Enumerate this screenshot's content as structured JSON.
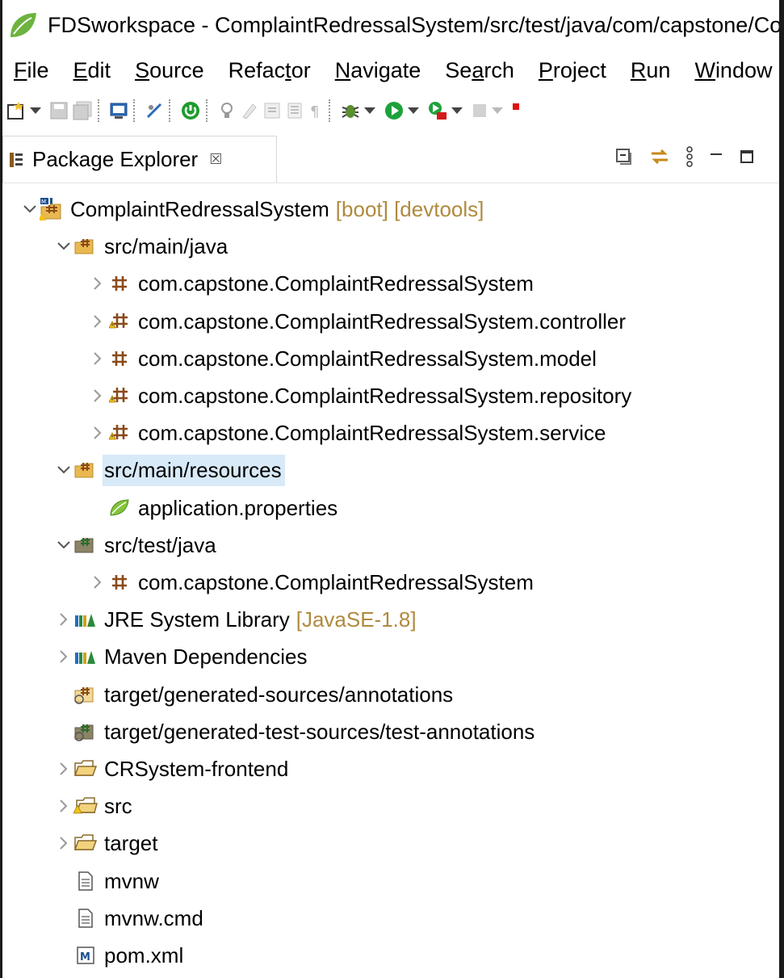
{
  "window": {
    "title": "FDSworkspace - ComplaintRedressalSystem/src/test/java/com/capstone/ComplaintRedressalSystem - Eclipse IDE"
  },
  "menu": [
    {
      "label": "File",
      "u": "F",
      "rest": "ile"
    },
    {
      "label": "Edit",
      "u": "E",
      "rest": "dit"
    },
    {
      "label": "Source",
      "u": "S",
      "rest": "ource"
    },
    {
      "label": "Refactor",
      "pre": "Refac",
      "u": "t",
      "rest": "or"
    },
    {
      "label": "Navigate",
      "u": "N",
      "rest": "avigate"
    },
    {
      "label": "Search",
      "pre": "Se",
      "u": "a",
      "rest": "rch"
    },
    {
      "label": "Project",
      "u": "P",
      "rest": "roject"
    },
    {
      "label": "Run",
      "u": "R",
      "rest": "un"
    },
    {
      "label": "Window",
      "u": "W",
      "rest": "indow"
    }
  ],
  "view": {
    "tab_label": "Package Explorer",
    "close_glyph": "☒"
  },
  "tree": [
    {
      "label": "ComplaintRedressalSystem",
      "decor": "[boot] [devtools]",
      "icon": "project-icon",
      "level": 0,
      "expanded": true
    },
    {
      "label": "src/main/java",
      "icon": "source-folder-icon",
      "level": 1,
      "expanded": true
    },
    {
      "label": "com.capstone.ComplaintRedressalSystem",
      "icon": "package-icon",
      "level": 2,
      "expanded": false
    },
    {
      "label": "com.capstone.ComplaintRedressalSystem.controller",
      "icon": "package-warning-icon",
      "level": 2,
      "expanded": false
    },
    {
      "label": "com.capstone.ComplaintRedressalSystem.model",
      "icon": "package-icon",
      "level": 2,
      "expanded": false
    },
    {
      "label": "com.capstone.ComplaintRedressalSystem.repository",
      "icon": "package-warning-icon",
      "level": 2,
      "expanded": false
    },
    {
      "label": "com.capstone.ComplaintRedressalSystem.service",
      "icon": "package-warning-icon",
      "level": 2,
      "expanded": false
    },
    {
      "label": "src/main/resources",
      "icon": "source-folder-icon",
      "level": 1,
      "expanded": true,
      "selected": true
    },
    {
      "label": "application.properties",
      "icon": "spring-leaf-icon",
      "level": 2
    },
    {
      "label": "src/test/java",
      "icon": "test-source-folder-icon",
      "level": 1,
      "expanded": true
    },
    {
      "label": "com.capstone.ComplaintRedressalSystem",
      "icon": "package-icon",
      "level": 2,
      "expanded": false
    },
    {
      "label": "JRE System Library",
      "decor": "[JavaSE-1.8]",
      "icon": "library-icon",
      "level": 1,
      "expanded": false
    },
    {
      "label": "Maven Dependencies",
      "icon": "library-icon",
      "level": 1,
      "expanded": false
    },
    {
      "label": "target/generated-sources/annotations",
      "icon": "gen-source-folder-icon",
      "level": 1
    },
    {
      "label": "target/generated-test-sources/test-annotations",
      "icon": "gen-test-source-folder-icon",
      "level": 1
    },
    {
      "label": "CRSystem-frontend",
      "icon": "folder-icon",
      "level": 1,
      "expanded": false
    },
    {
      "label": "src",
      "icon": "folder-warning-icon",
      "level": 1,
      "expanded": false
    },
    {
      "label": "target",
      "icon": "folder-icon",
      "level": 1,
      "expanded": false
    },
    {
      "label": "mvnw",
      "icon": "file-icon",
      "level": 1
    },
    {
      "label": "mvnw.cmd",
      "icon": "file-icon",
      "level": 1
    },
    {
      "label": "pom.xml",
      "icon": "maven-pom-icon",
      "level": 1
    }
  ],
  "colors": {
    "selection": "#d8e9f8",
    "decoration": "#b08a3e",
    "package": "#8a5a1e",
    "folder": "#e8b84a"
  }
}
